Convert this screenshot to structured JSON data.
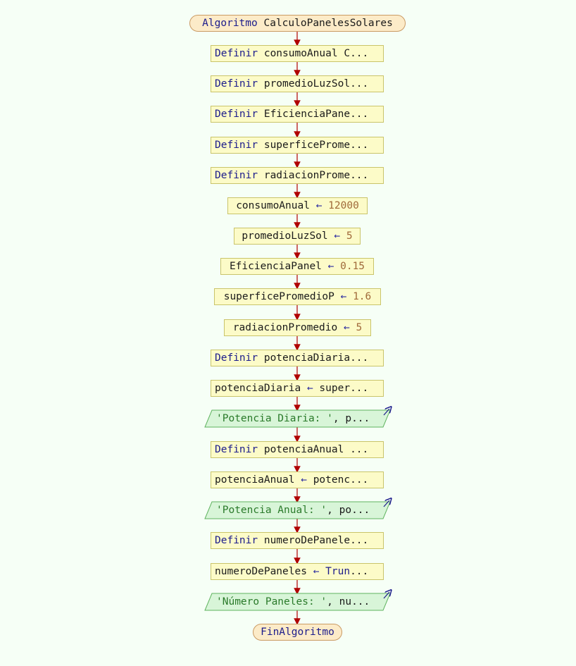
{
  "start": {
    "keyword": "Algoritmo",
    "name": "CalculoPanelesSolares"
  },
  "end": {
    "label": "FinAlgoritmo"
  },
  "defines": [
    {
      "keyword": "Definir",
      "text": "consumoAnual C",
      "ellipsis": "..."
    },
    {
      "keyword": "Definir",
      "text": "promedioLuzSol",
      "ellipsis": "..."
    },
    {
      "keyword": "Definir",
      "text": "EficienciaPane",
      "ellipsis": "..."
    },
    {
      "keyword": "Definir",
      "text": "superficeProme",
      "ellipsis": "..."
    },
    {
      "keyword": "Definir",
      "text": "radiacionProme",
      "ellipsis": "..."
    },
    {
      "keyword": "Definir",
      "text": "potenciaDiaria",
      "ellipsis": "..."
    },
    {
      "keyword": "Definir",
      "text": "potenciaAnual ",
      "ellipsis": "..."
    },
    {
      "keyword": "Definir",
      "text": "numeroDePanele",
      "ellipsis": "..."
    }
  ],
  "assignments": [
    {
      "var": "consumoAnual",
      "arrow": "←",
      "value": "12000"
    },
    {
      "var": "promedioLuzSol",
      "arrow": "←",
      "value": "5"
    },
    {
      "var": "EficienciaPanel",
      "arrow": "←",
      "value": "0.15"
    },
    {
      "var": "superficePromedioP",
      "arrow": "←",
      "value": "1.6"
    },
    {
      "var": "radiacionPromedio",
      "arrow": "←",
      "value": "5"
    },
    {
      "var": "potenciaDiaria",
      "arrow": "←",
      "expr": "super",
      "ellipsis": "..."
    },
    {
      "var": "potenciaAnual",
      "arrow": "←",
      "expr": "potenc",
      "ellipsis": "..."
    },
    {
      "var": "numeroDePaneles",
      "arrow": "←",
      "expr": "Trun",
      "ellipsis": "..."
    }
  ],
  "outputs": [
    {
      "string": "'Potencia Diaria: '",
      "rest": ", p",
      "ellipsis": "..."
    },
    {
      "string": "'Potencia Anual: '",
      "rest": ", po",
      "ellipsis": "..."
    },
    {
      "string": "'Número Paneles: '",
      "rest": ", nu",
      "ellipsis": "..."
    }
  ],
  "colors": {
    "background": "#f6fff6",
    "terminal_fill": "#fcebc8",
    "process_fill": "#fcfbc8",
    "io_fill": "#d8f5d8",
    "arrow": "#b00000",
    "keyword": "#1c1c8c",
    "number": "#a06a3a",
    "string": "#2a7a2a"
  }
}
